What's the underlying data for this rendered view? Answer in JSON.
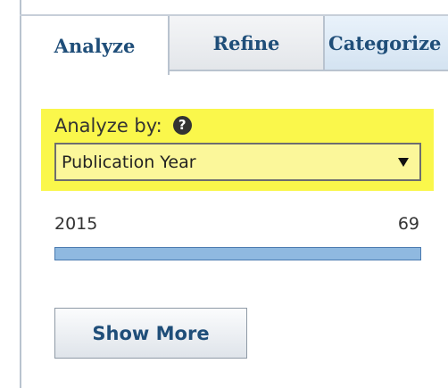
{
  "tabs": [
    {
      "label": "Analyze",
      "active": true
    },
    {
      "label": "Refine",
      "active": false
    },
    {
      "label": "Categorize",
      "active": false
    }
  ],
  "analyze": {
    "label": "Analyze by:",
    "help_icon": "question-circle-icon",
    "select_value": "Publication Year",
    "dropdown_icon": "triangle-down-icon"
  },
  "results": {
    "year": "2015",
    "count": "69",
    "bar_fraction": 1.0
  },
  "show_more_label": "Show More",
  "colors": {
    "highlight": "#faf74b",
    "tab_text": "#1f4e79",
    "bar_fill": "#8fb9e0"
  }
}
